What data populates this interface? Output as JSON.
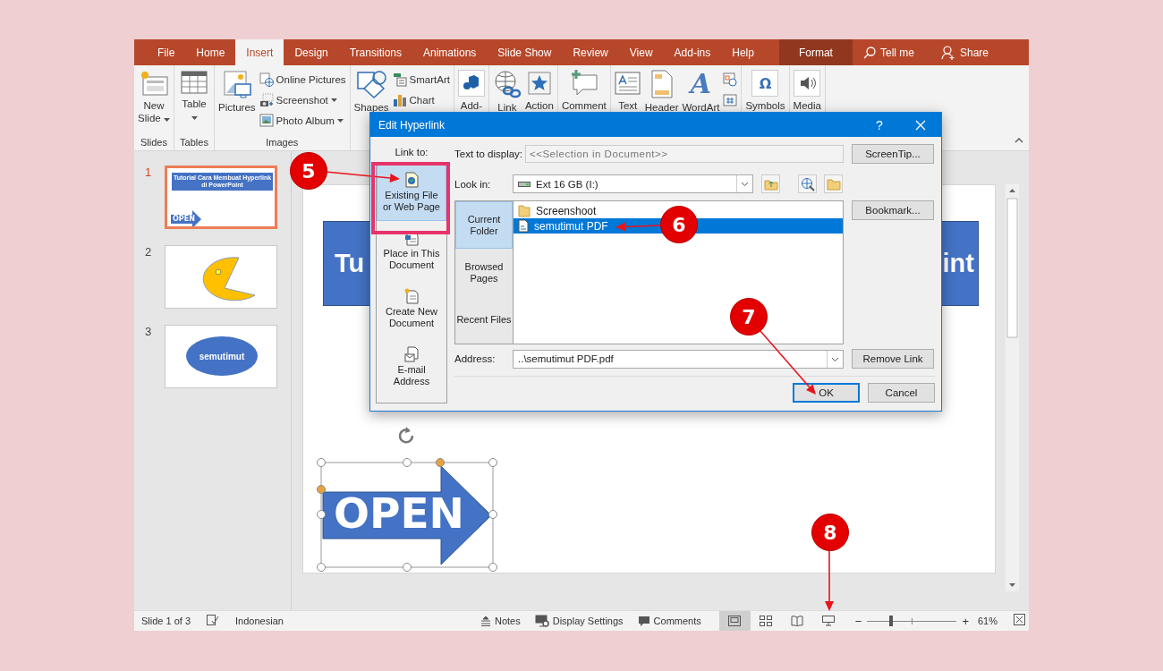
{
  "tabs": [
    {
      "label": "File",
      "selected": false,
      "kind": "plain"
    },
    {
      "label": "Home",
      "selected": false,
      "kind": "plain"
    },
    {
      "label": "Insert",
      "selected": true,
      "kind": "plain"
    },
    {
      "label": "Design",
      "selected": false,
      "kind": "plain"
    },
    {
      "label": "Transitions",
      "selected": false,
      "kind": "plain"
    },
    {
      "label": "Animations",
      "selected": false,
      "kind": "plain"
    },
    {
      "label": "Slide Show",
      "selected": false,
      "kind": "plain"
    },
    {
      "label": "Review",
      "selected": false,
      "kind": "plain"
    },
    {
      "label": "View",
      "selected": false,
      "kind": "plain"
    },
    {
      "label": "Add-ins",
      "selected": false,
      "kind": "plain"
    },
    {
      "label": "Help",
      "selected": false,
      "kind": "plain"
    },
    {
      "label": "Format",
      "selected": false,
      "kind": "context"
    }
  ],
  "tell_me": "Tell me",
  "share": "Share",
  "ribbon": [
    {
      "label": "Slides",
      "items": [
        {
          "label": "New Slide",
          "kind": "large",
          "dropdown": true
        }
      ]
    },
    {
      "label": "Tables",
      "items": [
        {
          "label": "Table",
          "kind": "large",
          "dropdown": true
        }
      ]
    },
    {
      "label": "Images",
      "items": [
        {
          "label": "Pictures",
          "kind": "large"
        },
        {
          "label": "Online Pictures",
          "kind": "small"
        },
        {
          "label": "Screenshot",
          "kind": "small",
          "dropdown": true
        },
        {
          "label": "Photo Album",
          "kind": "small",
          "dropdown": true
        }
      ]
    },
    {
      "items": [
        {
          "label": "Shapes",
          "kind": "large"
        },
        {
          "label": "SmartArt",
          "kind": "small"
        },
        {
          "label": "Chart",
          "kind": "small"
        }
      ]
    },
    {
      "items": [
        {
          "label": "Add-",
          "kind": "large"
        }
      ]
    },
    {
      "items": [
        {
          "label": "Link",
          "kind": "large"
        },
        {
          "label": "Action",
          "kind": "large"
        }
      ]
    },
    {
      "items": [
        {
          "label": "Comment",
          "kind": "large"
        }
      ]
    },
    {
      "items": [
        {
          "label": "Text",
          "kind": "large"
        },
        {
          "label": "Header",
          "kind": "large"
        },
        {
          "label": "WordArt",
          "kind": "glyph",
          "glyph": "A"
        },
        {
          "kind": "stack"
        }
      ]
    },
    {
      "items": [
        {
          "label": "Symbols",
          "kind": "glyph",
          "glyph": "Ω"
        }
      ]
    },
    {
      "items": [
        {
          "label": "Media",
          "kind": "large"
        }
      ]
    }
  ],
  "slides": [
    {
      "number": "1",
      "selected": true,
      "kind": "title-arrow",
      "title": "Tutorial Cara Membuat Hyperlink di PowerPoint",
      "button": "OPEN"
    },
    {
      "number": "2",
      "selected": false,
      "kind": "pacman"
    },
    {
      "number": "3",
      "selected": false,
      "kind": "ellipse",
      "text": "semutimut"
    }
  ],
  "slide": {
    "title_left": "Tu",
    "title_right": "int",
    "arrow": {
      "text": "OPEN",
      "selected": true
    }
  },
  "dialog": {
    "title": "Edit Hyperlink",
    "help": "?",
    "link_to_label": "Link to:",
    "link_to": [
      {
        "label": "Existing File or Web Page",
        "selected": true
      },
      {
        "label": "Place in This Document",
        "selected": false
      },
      {
        "label": "Create New Document",
        "selected": false
      },
      {
        "label": "E-mail Address",
        "selected": false
      }
    ],
    "text_to_display": {
      "label": "Text to display:",
      "placeholder": "<<Selection in Document>>"
    },
    "screentip": "ScreenTip...",
    "look_in": {
      "label": "Look in:",
      "value": "Ext 16 GB (I:)"
    },
    "nav": [
      {
        "label": "Current Folder",
        "selected": true
      },
      {
        "label": "Browsed Pages",
        "selected": false
      },
      {
        "label": "Recent Files",
        "selected": false
      }
    ],
    "files": [
      {
        "name": "Screenshoot",
        "kind": "folder",
        "selected": false
      },
      {
        "name": "semutimut PDF",
        "kind": "pdf",
        "selected": true
      }
    ],
    "bookmark": "Bookmark...",
    "address": {
      "label": "Address:",
      "value": "..\\semutimut PDF.pdf"
    },
    "remove_link": "Remove Link",
    "ok": "OK",
    "cancel": "Cancel"
  },
  "status_bar": {
    "slide_info": "Slide 1 of 3",
    "language": "Indonesian",
    "buttons": [
      {
        "label": "Notes"
      },
      {
        "label": "Display Settings"
      },
      {
        "label": "Comments"
      }
    ],
    "views": [
      {
        "kind": "normal",
        "selected": true
      },
      {
        "kind": "sorter",
        "selected": false
      },
      {
        "kind": "reading",
        "selected": false
      },
      {
        "kind": "slideshow",
        "selected": false
      }
    ],
    "zoom_out": "−",
    "zoom_in": "+",
    "zoom": {
      "level": 0.27
    },
    "zoom_percent": "61%"
  },
  "annotations": [
    {
      "label": "5"
    },
    {
      "label": "6"
    },
    {
      "label": "7"
    },
    {
      "label": "8"
    }
  ]
}
